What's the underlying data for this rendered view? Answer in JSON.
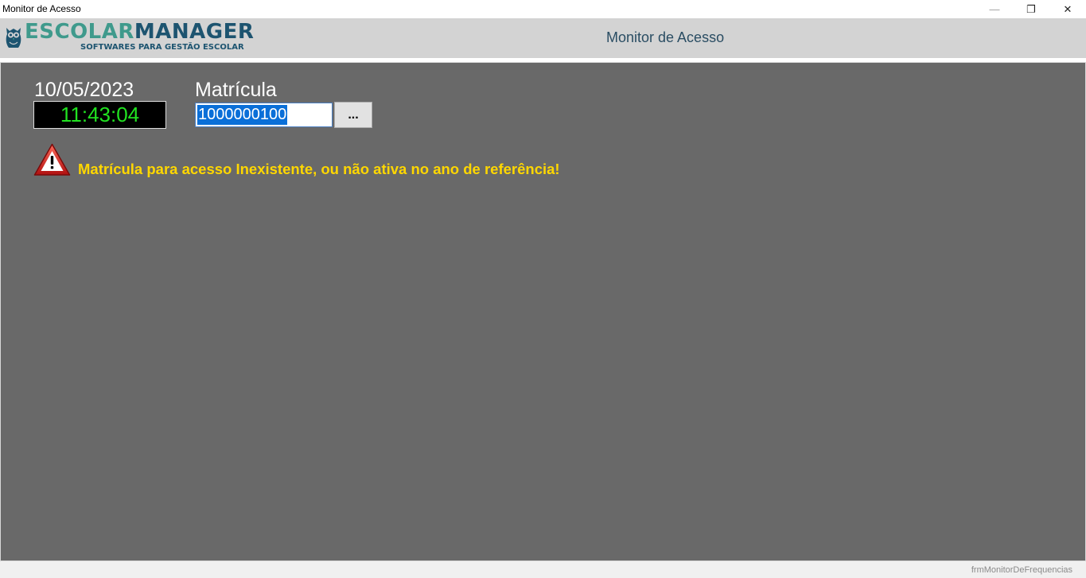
{
  "window": {
    "title": "Monitor de Acesso",
    "minimize_glyph": "—",
    "maximize_glyph": "❐",
    "close_glyph": "✕"
  },
  "header": {
    "logo_escolar": "ESCOLAR",
    "logo_manager": "MANAGER",
    "logo_tagline": "SOFTWARES PARA GESTÃO ESCOLAR",
    "title": "Monitor de Acesso"
  },
  "main": {
    "date": "10/05/2023",
    "clock": "11:43:04",
    "matricula_label": "Matrícula",
    "matricula_value": "1000000100",
    "browse_button_label": "...",
    "warning_icon": "warning-triangle-icon",
    "warning_message": "Matrícula para acesso Inexistente, ou não ativa no ano de referência!"
  },
  "statusbar": {
    "form_name": "frmMonitorDeFrequencias"
  },
  "colors": {
    "panel_background": "#696969",
    "header_background": "#d3d3d3",
    "clock_text": "#21e221",
    "warning_text": "#ffd700",
    "selection": "#0a6fd8"
  }
}
